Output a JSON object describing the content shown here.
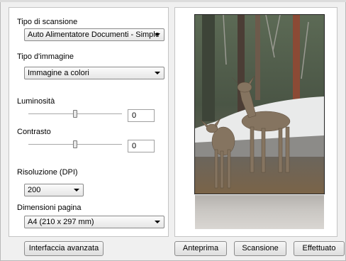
{
  "scan_type": {
    "label": "Tipo di scansione",
    "value": "Auto Alimentatore Documenti - Simple"
  },
  "image_type": {
    "label": "Tipo d'immagine",
    "value": "Immagine a colori"
  },
  "brightness": {
    "label": "Luminosità",
    "value": "0"
  },
  "contrast": {
    "label": "Contrasto",
    "value": "0"
  },
  "resolution": {
    "label": "Risoluzione (DPI)",
    "value": "200"
  },
  "page_size": {
    "label": "Dimensioni pagina",
    "value": "A4 (210 x 297 mm)"
  },
  "buttons": {
    "advanced": "Interfaccia avanzata",
    "preview": "Anteprima",
    "scan": "Scansione",
    "done": "Effettuato"
  }
}
